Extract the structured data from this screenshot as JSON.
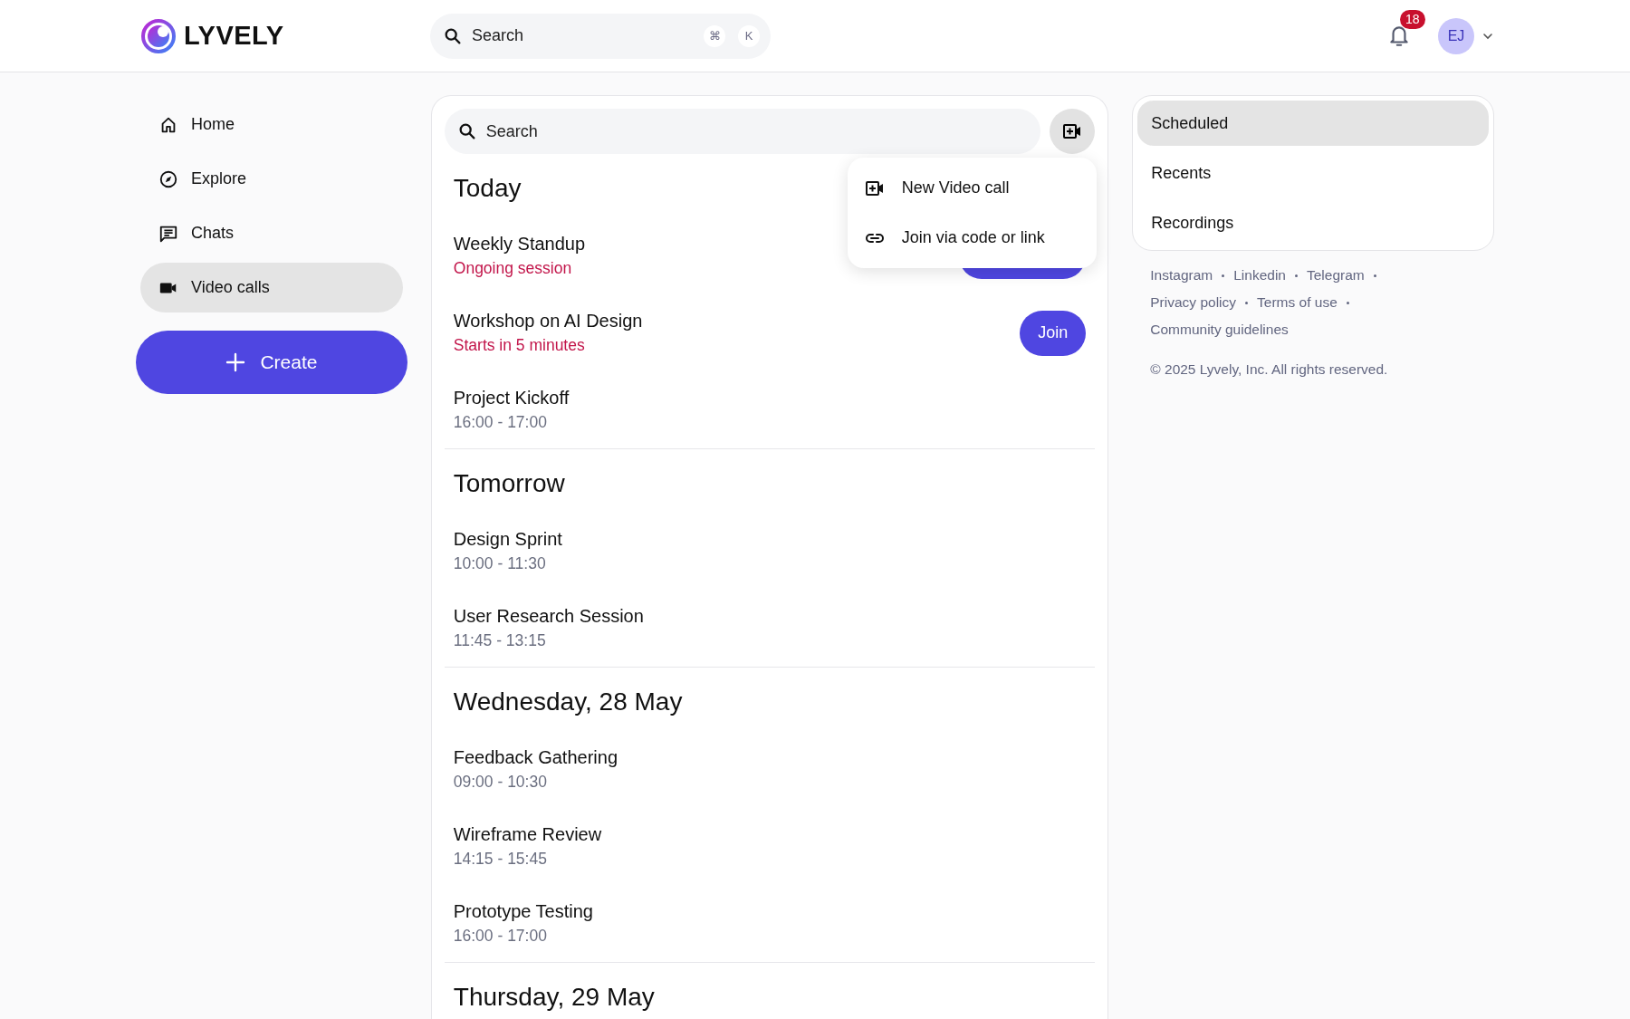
{
  "header": {
    "logo": "LYVELY",
    "search": {
      "placeholder": "Search",
      "shortcut": [
        "⌘",
        "K"
      ]
    },
    "notifications": "18",
    "avatar": "EJ"
  },
  "nav": [
    {
      "label": "Home",
      "selected": false
    },
    {
      "label": "Explore",
      "selected": false
    },
    {
      "label": "Chats",
      "selected": false
    },
    {
      "label": "Video calls",
      "selected": true
    }
  ],
  "create_button": "Create",
  "main": {
    "search": {
      "placeholder": "Search"
    },
    "menu": [
      {
        "label": "New Video call"
      },
      {
        "label": "Join via code or link"
      }
    ],
    "sections": [
      {
        "title": "Today",
        "meetings": [
          {
            "title": "Weekly Standup",
            "subtitle": "Ongoing session",
            "kind": "live",
            "button_covered": true
          },
          {
            "title": "Workshop on AI Design",
            "subtitle": "Starts in 5 minutes",
            "kind": "live",
            "action": "Join"
          },
          {
            "title": "Project Kickoff",
            "subtitle": "16:00 - 17:00",
            "kind": "time"
          }
        ]
      },
      {
        "title": "Tomorrow",
        "meetings": [
          {
            "title": "Design Sprint",
            "subtitle": "10:00 - 11:30",
            "kind": "time"
          },
          {
            "title": "User Research Session",
            "subtitle": "11:45 - 13:15",
            "kind": "time"
          }
        ]
      },
      {
        "title": "Wednesday, 28 May",
        "meetings": [
          {
            "title": "Feedback Gathering",
            "subtitle": "09:00 - 10:30",
            "kind": "time"
          },
          {
            "title": "Wireframe Review",
            "subtitle": "14:15 - 15:45",
            "kind": "time"
          },
          {
            "title": "Prototype Testing",
            "subtitle": "16:00 - 17:00",
            "kind": "time"
          }
        ]
      },
      {
        "title": "Thursday, 29 May"
      }
    ]
  },
  "tabs": [
    {
      "label": "Scheduled",
      "selected": true
    },
    {
      "label": "Recents",
      "selected": false
    },
    {
      "label": "Recordings",
      "selected": false
    }
  ],
  "footer": {
    "links": [
      [
        "Instagram",
        "Linkedin",
        "Telegram"
      ],
      [
        "Privacy policy",
        "Terms of use"
      ],
      [
        "Community guidelines"
      ]
    ],
    "copyright": "© 2025 Lyvely, Inc. All rights reserved."
  }
}
